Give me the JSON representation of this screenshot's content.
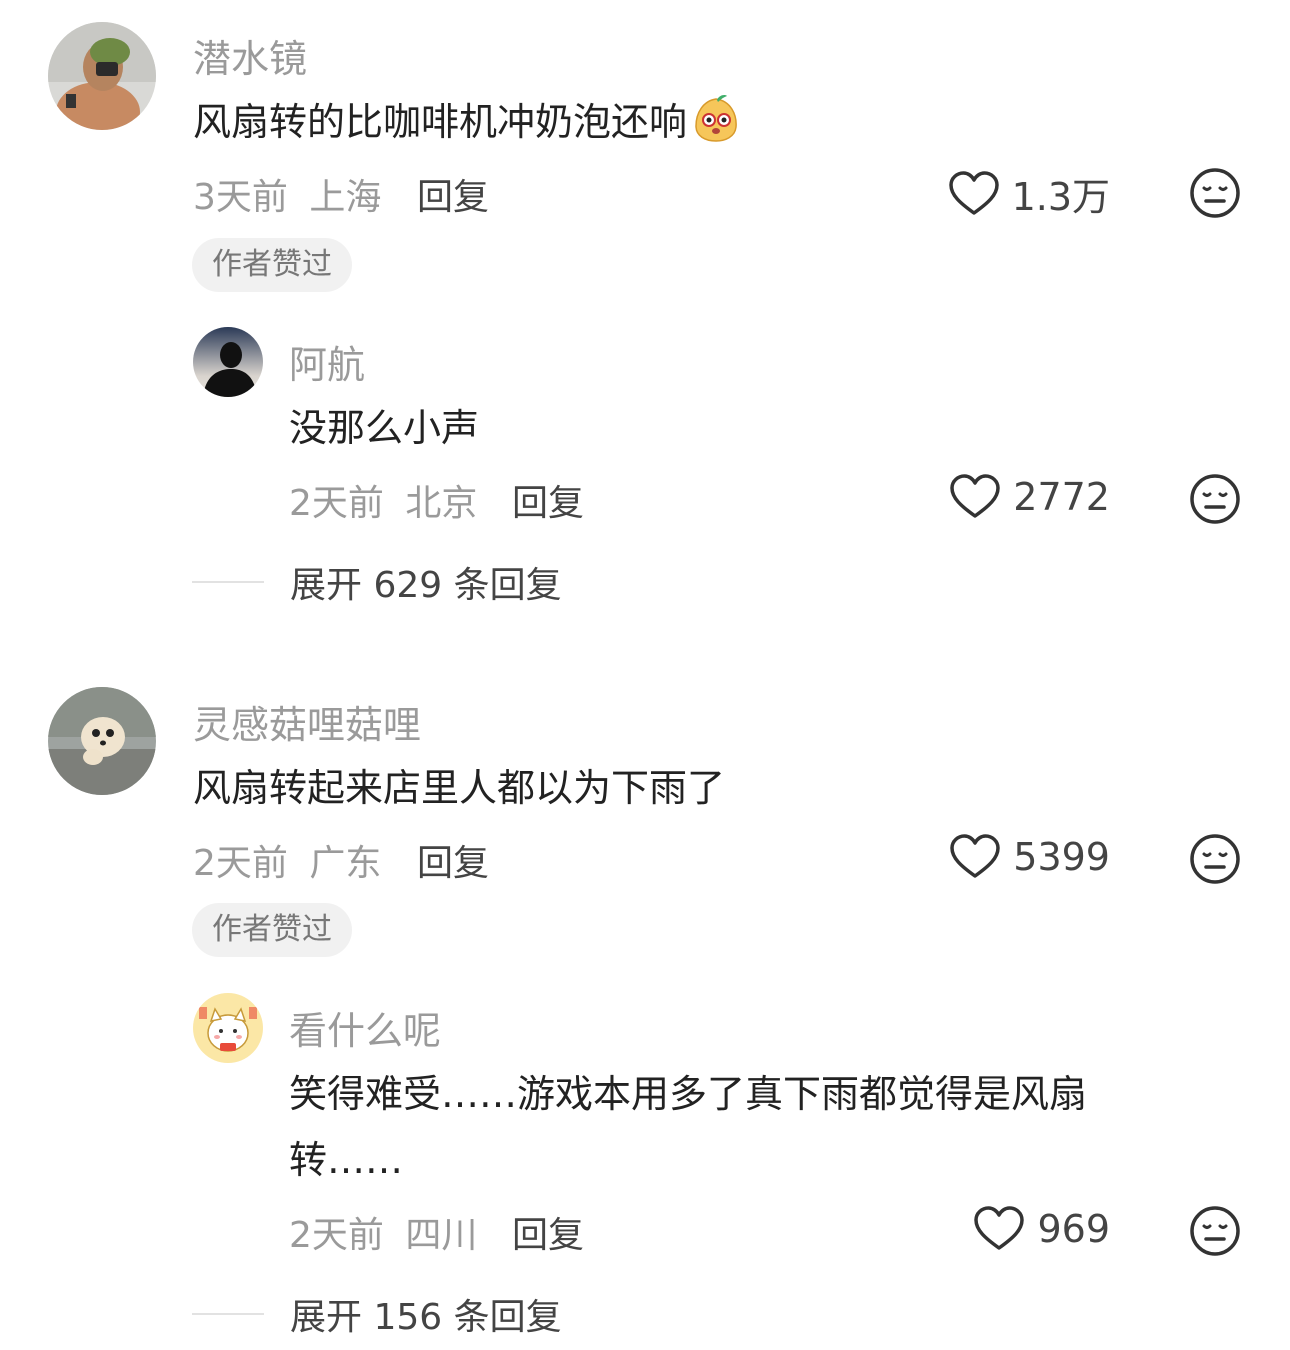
{
  "comments": [
    {
      "username": "潜水镜",
      "text": "风扇转的比咖啡机冲奶泡还响",
      "emoji": "mango-face-emoji",
      "time": "3天前",
      "location": "上海",
      "reply_label": "回复",
      "likes": "1.3万",
      "badge": "作者赞过",
      "replies": [
        {
          "username": "阿航",
          "text": "没那么小声",
          "time": "2天前",
          "location": "北京",
          "reply_label": "回复",
          "likes": "2772"
        }
      ],
      "expand_label": "展开 629 条回复"
    },
    {
      "username": "灵感菇哩菇哩",
      "text": "风扇转起来店里人都以为下雨了",
      "time": "2天前",
      "location": "广东",
      "reply_label": "回复",
      "likes": "5399",
      "badge": "作者赞过",
      "replies": [
        {
          "username": "看什么呢",
          "text_line1": "笑得难受……游戏本用多了真下雨都觉得是风扇",
          "text_line2": "转……",
          "time": "2天前",
          "location": "四川",
          "reply_label": "回复",
          "likes": "969"
        }
      ],
      "expand_label": "展开 156 条回复"
    }
  ],
  "icons": {
    "like": "heart-outline-icon",
    "dislike": "neutral-face-icon"
  },
  "colors": {
    "muted": "#9a9a9a",
    "text": "#222222",
    "badge_bg": "#f1f1f1"
  }
}
